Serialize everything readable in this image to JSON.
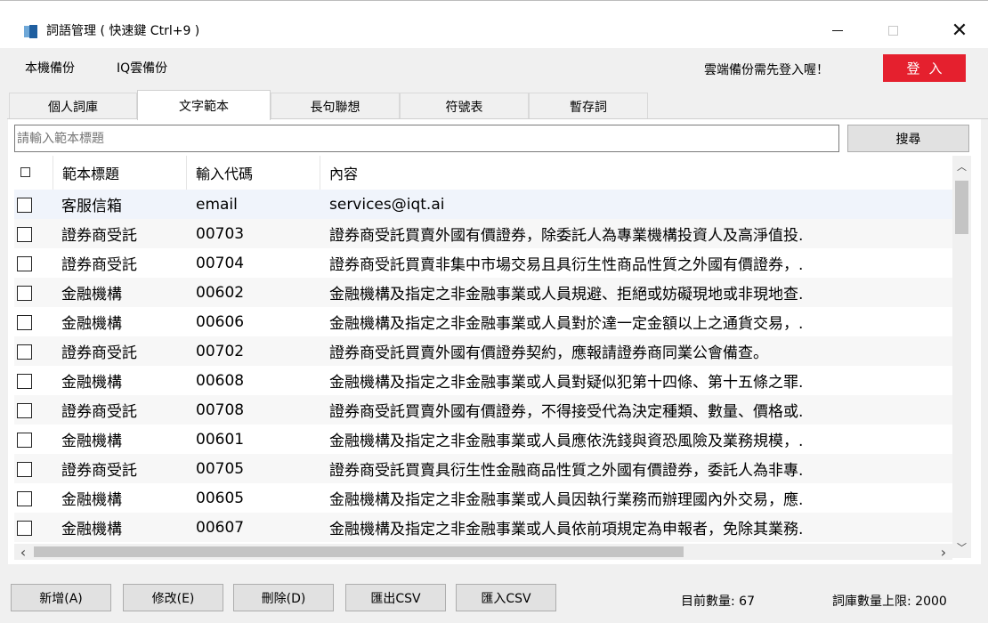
{
  "window": {
    "title": "詞語管理 ( 快速鍵 Ctrl+9 )",
    "controls": {
      "minimize": "—",
      "maximize": "□",
      "close": "✕"
    }
  },
  "menu": {
    "local_backup": "本機備份",
    "iq_cloud_backup": "IQ雲備份",
    "cloud_notice": "雲端備份需先登入喔！",
    "login_label": "登入"
  },
  "tabs": [
    {
      "label": "個人詞庫",
      "active": false
    },
    {
      "label": "文字範本",
      "active": true
    },
    {
      "label": "長句聯想",
      "active": false
    },
    {
      "label": "符號表",
      "active": false
    },
    {
      "label": "暫存詞",
      "active": false
    }
  ],
  "search": {
    "placeholder": "請輸入範本標題",
    "button_label": "搜尋"
  },
  "table": {
    "headers": {
      "check": "",
      "title": "範本標題",
      "code": "輸入代碼",
      "content": "內容"
    },
    "rows": [
      {
        "title": "客服信箱",
        "code": "email",
        "content": "services@iqt.ai"
      },
      {
        "title": "證券商受託",
        "code": "00703",
        "content": "證券商受託買賣外國有價證券，除委託人為專業機構投資人及高淨值投."
      },
      {
        "title": "證券商受託",
        "code": "00704",
        "content": "證券商受託買賣非集中市場交易且具衍生性商品性質之外國有價證券，."
      },
      {
        "title": "金融機構",
        "code": "00602",
        "content": "金融機構及指定之非金融事業或人員規避、拒絕或妨礙現地或非現地查."
      },
      {
        "title": "金融機構",
        "code": "00606",
        "content": "金融機構及指定之非金融事業或人員對於達一定金額以上之通貨交易，."
      },
      {
        "title": "證券商受託",
        "code": "00702",
        "content": "證券商受託買賣外國有價證券契約，應報請證券商同業公會備查。"
      },
      {
        "title": "金融機構",
        "code": "00608",
        "content": "金融機構及指定之非金融事業或人員對疑似犯第十四條、第十五條之罪."
      },
      {
        "title": "證券商受託",
        "code": "00708",
        "content": "證券商受託買賣外國有價證券，不得接受代為決定種類、數量、價格或."
      },
      {
        "title": "金融機構",
        "code": "00601",
        "content": "金融機構及指定之非金融事業或人員應依洗錢與資恐風險及業務規模，."
      },
      {
        "title": "證券商受託",
        "code": "00705",
        "content": "證券商受託買賣具衍生性金融商品性質之外國有價證券，委託人為非專."
      },
      {
        "title": "金融機構",
        "code": "00605",
        "content": "金融機構及指定之非金融事業或人員因執行業務而辦理國內外交易，應."
      },
      {
        "title": "金融機構",
        "code": "00607",
        "content": "金融機構及指定之非金融事業或人員依前項規定為申報者，免除其業務."
      }
    ]
  },
  "buttons": {
    "add": "新增(A)",
    "edit": "修改(E)",
    "delete": "刪除(D)",
    "export_csv": "匯出CSV",
    "import_csv": "匯入CSV"
  },
  "status": {
    "current_count": "目前數量: 67",
    "max_count": "詞庫數量上限: 2000"
  },
  "colors": {
    "login": "#e5202e",
    "active_tab": "#ffffff"
  }
}
